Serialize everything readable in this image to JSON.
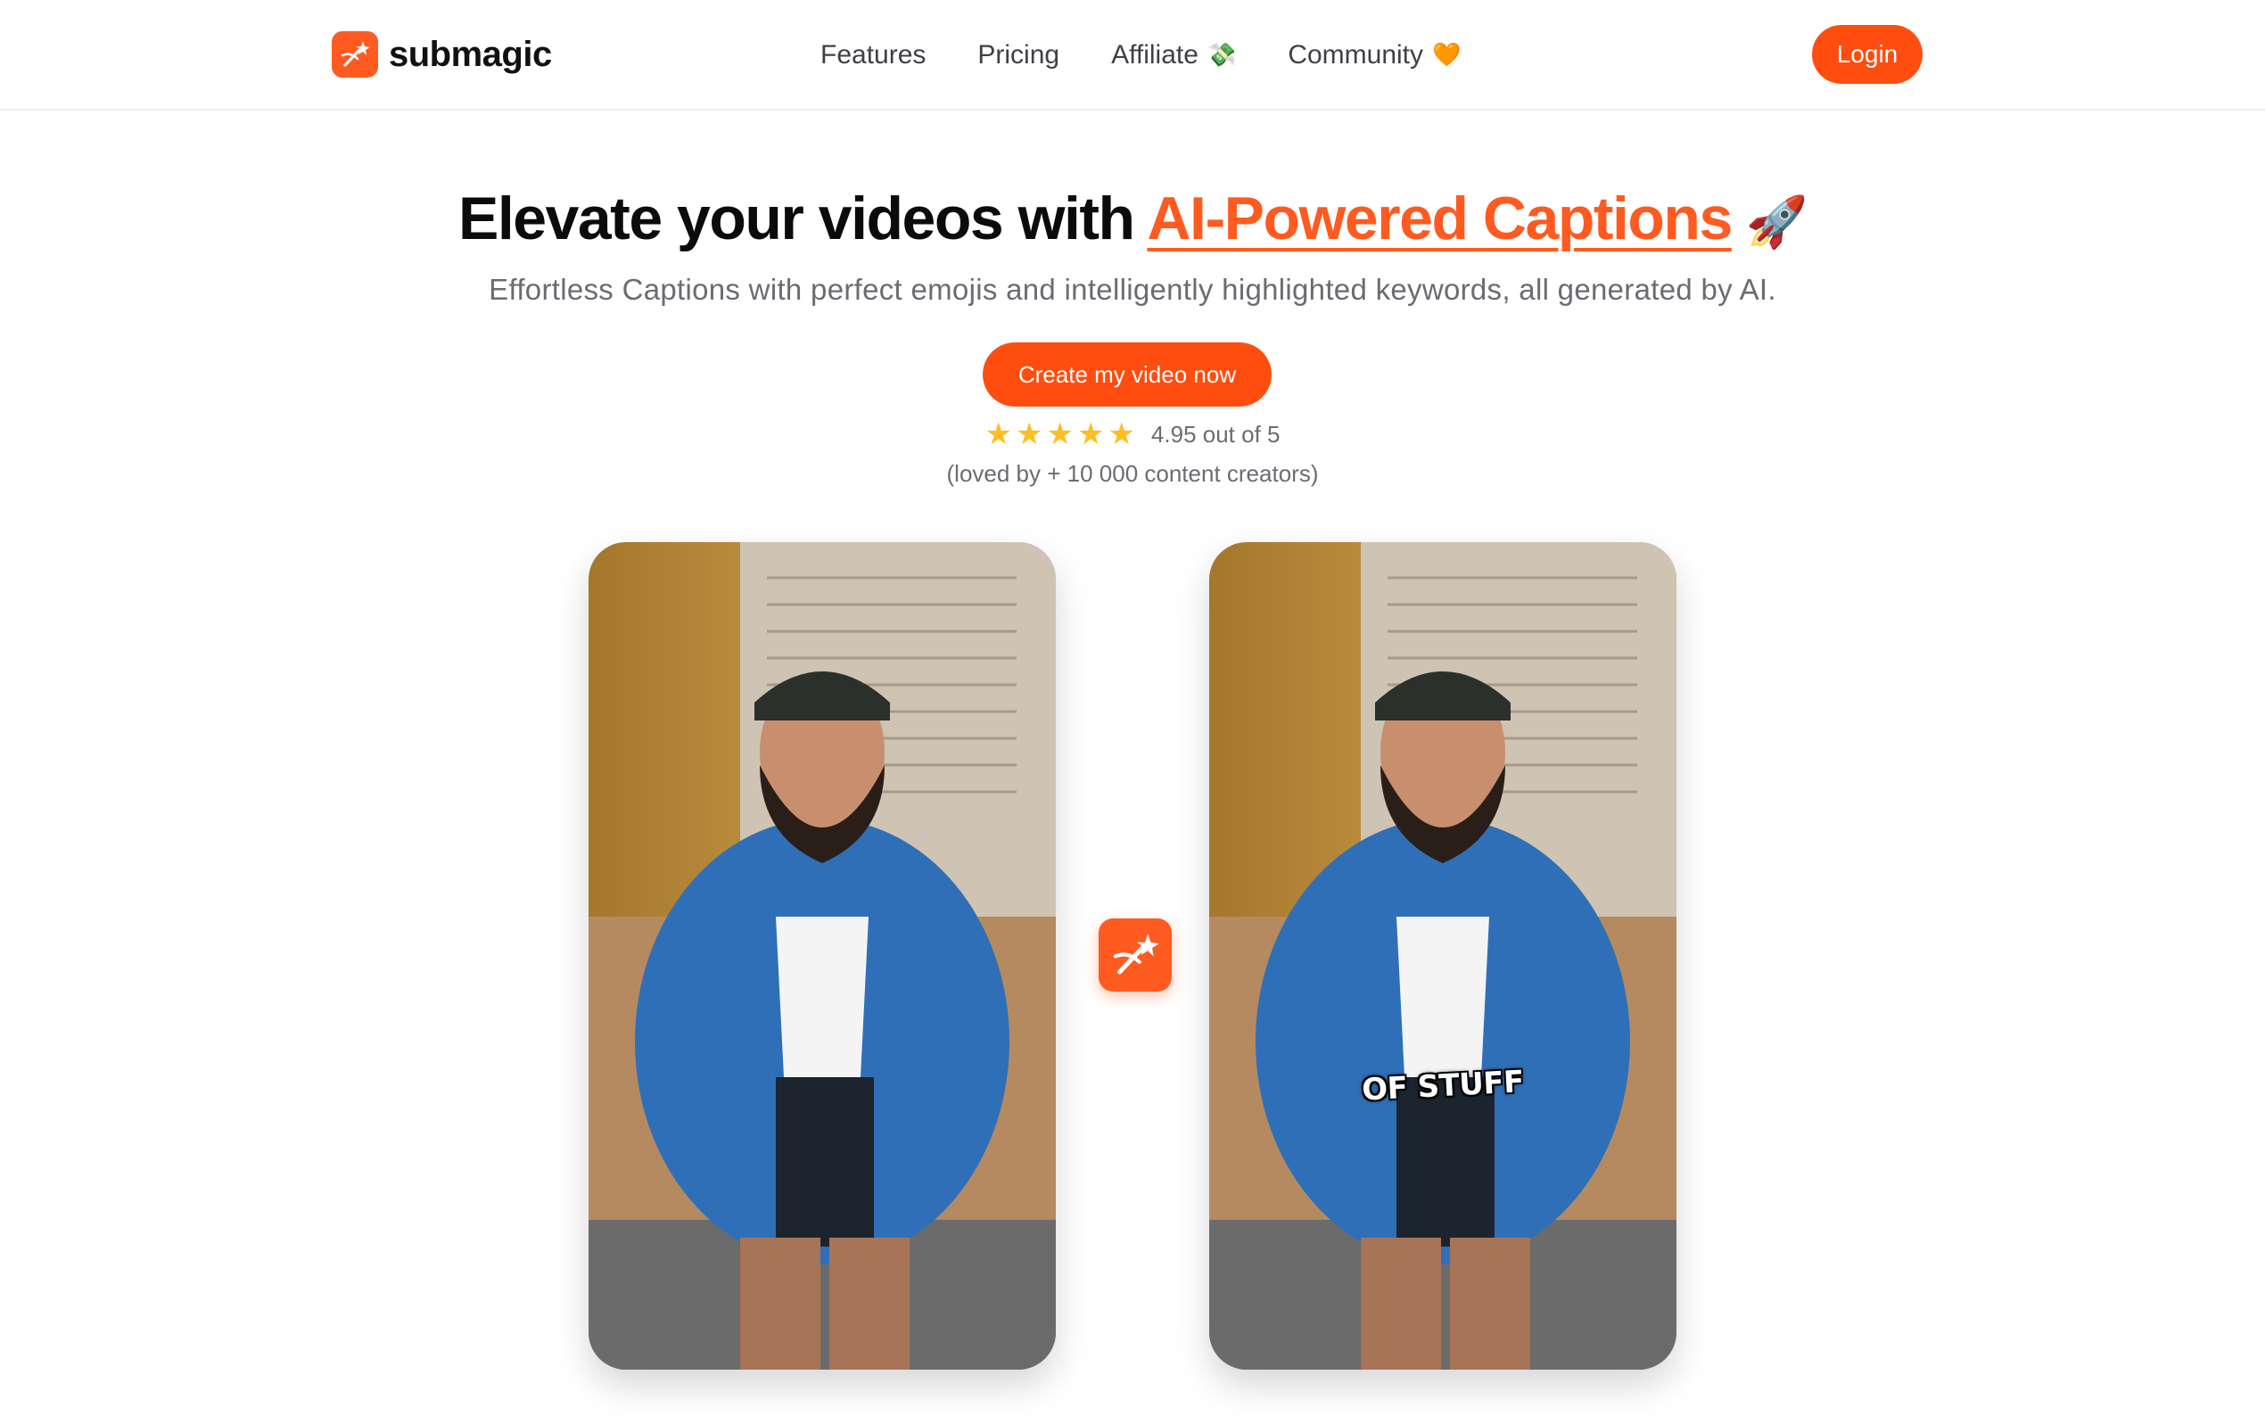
{
  "brand": {
    "name": "submagic",
    "logo_icon": "magic-wand-icon",
    "accent_color": "#ff5a1f"
  },
  "nav": {
    "items": [
      {
        "label": "Features"
      },
      {
        "label": "Pricing"
      },
      {
        "label": "Affiliate",
        "emoji": "💸"
      },
      {
        "label": "Community",
        "emoji": "🧡"
      }
    ],
    "login_label": "Login"
  },
  "hero": {
    "title_prefix": "Elevate your videos with ",
    "title_highlight": "AI-Powered Captions",
    "title_emoji": "🚀",
    "subtitle": "Effortless Captions with perfect emojis and intelligently highlighted keywords, all generated by AI.",
    "cta_label": "Create my video now",
    "rating_stars": 5,
    "rating_text": "4.95 out of 5",
    "loved_text": "(loved by + 10 000 content creators)"
  },
  "videos": {
    "before": {
      "caption": ""
    },
    "after": {
      "caption": "OF STUFF"
    },
    "badge_icon": "magic-wand-icon"
  }
}
